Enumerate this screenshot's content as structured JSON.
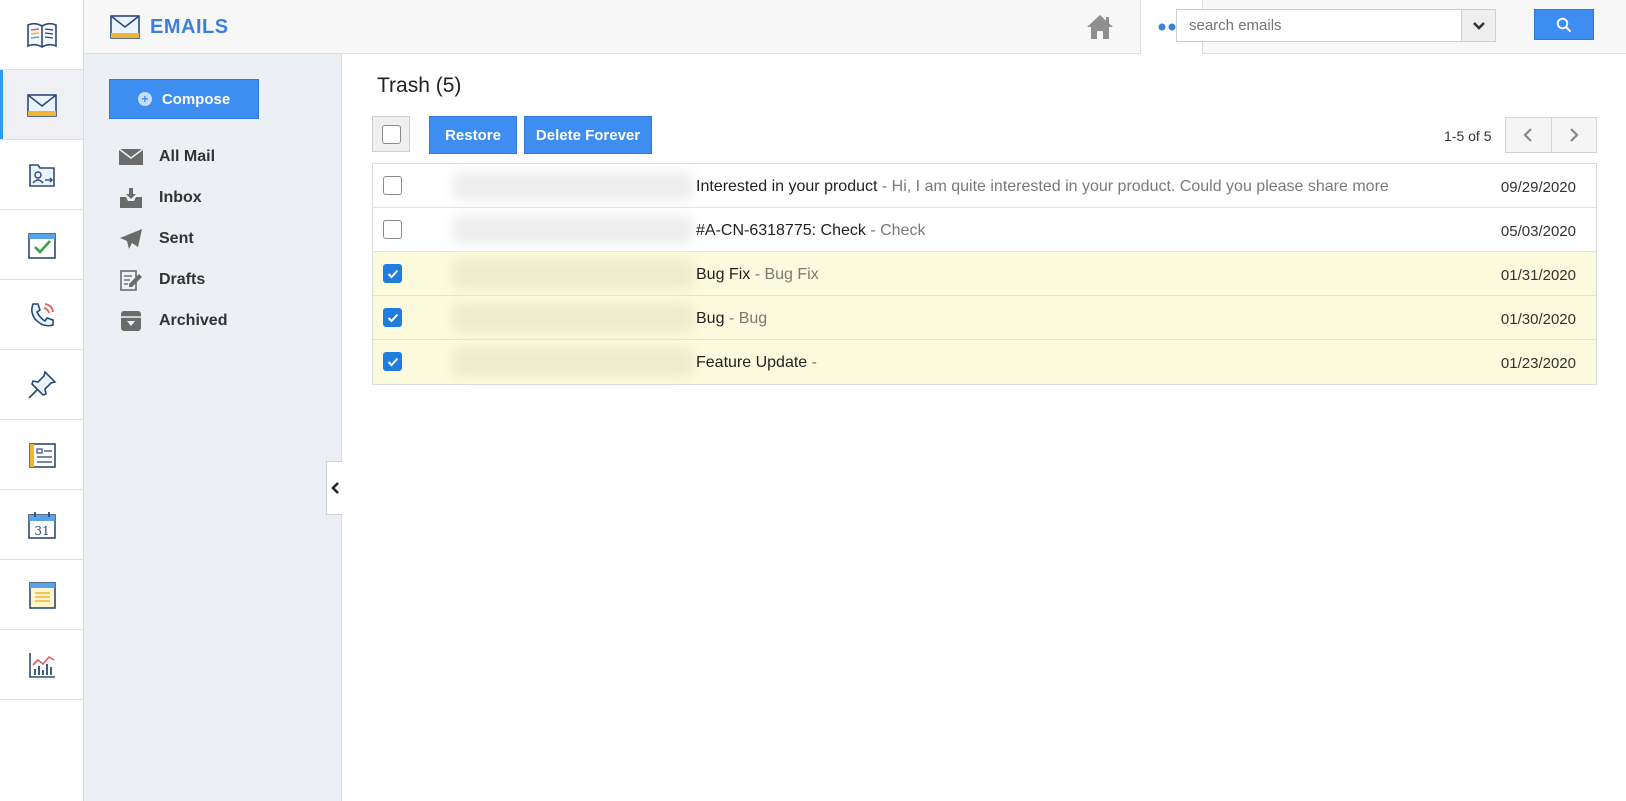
{
  "header": {
    "app_title": "EMAILS",
    "search_placeholder": "search emails"
  },
  "sidebar": {
    "compose_label": "Compose",
    "folders": [
      {
        "label": "All Mail",
        "icon": "envelope-icon"
      },
      {
        "label": "Inbox",
        "icon": "inbox-icon"
      },
      {
        "label": "Sent",
        "icon": "paper-plane-icon"
      },
      {
        "label": "Drafts",
        "icon": "drafts-icon"
      },
      {
        "label": "Archived",
        "icon": "archive-icon"
      }
    ]
  },
  "rail": {
    "items": [
      "book-icon",
      "mail-icon",
      "contacts-icon",
      "tasks-icon",
      "calls-icon",
      "pin-icon",
      "documents-icon",
      "calendar-icon",
      "notes-icon",
      "reports-icon"
    ],
    "calendar_day": "31"
  },
  "main": {
    "title": "Trash (5)",
    "restore_label": "Restore",
    "delete_label": "Delete Forever",
    "pager_text": "1-5 of 5",
    "emails": [
      {
        "subject": "Interested in your product",
        "snippet": " - Hi, I am quite interested in your product. Could you please share more",
        "date": "09/29/2020",
        "checked": false
      },
      {
        "subject": "#A-CN-6318775: Check",
        "snippet": " - Check",
        "date": "05/03/2020",
        "checked": false
      },
      {
        "subject": "Bug Fix",
        "snippet": " - Bug Fix",
        "date": "01/31/2020",
        "checked": true
      },
      {
        "subject": "Bug",
        "snippet": " - Bug",
        "date": "01/30/2020",
        "checked": true
      },
      {
        "subject": "Feature Update",
        "snippet": " - ",
        "date": "01/23/2020",
        "checked": true
      }
    ]
  },
  "colors": {
    "accent": "#3d8ef0",
    "selected_row": "#fbfadc",
    "sidebar_bg": "#eceff4"
  }
}
